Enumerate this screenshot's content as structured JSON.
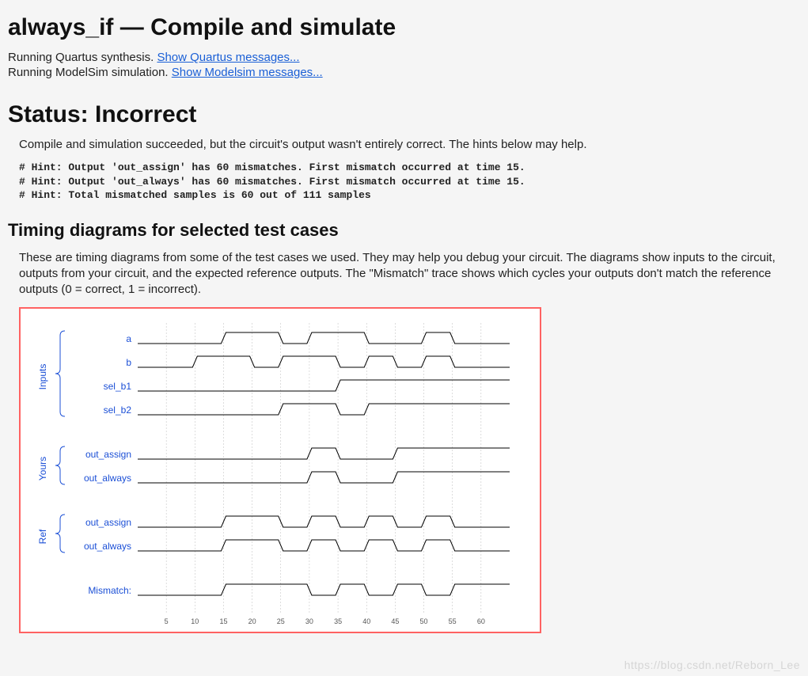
{
  "title": "always_if — Compile and simulate",
  "run": {
    "quartus_prefix": "Running Quartus synthesis. ",
    "quartus_link": "Show Quartus messages...",
    "modelsim_prefix": "Running ModelSim simulation. ",
    "modelsim_link": "Show Modelsim messages..."
  },
  "status": {
    "heading": "Status: Incorrect",
    "desc": "Compile and simulation succeeded, but the circuit's output wasn't entirely correct. The hints below may help."
  },
  "hints": "# Hint: Output 'out_assign' has 60 mismatches. First mismatch occurred at time 15.\n# Hint: Output 'out_always' has 60 mismatches. First mismatch occurred at time 15.\n# Hint: Total mismatched samples is 60 out of 111 samples",
  "timing": {
    "heading": "Timing diagrams for selected test cases",
    "desc": "These are timing diagrams from some of the test cases we used. They may help you debug your circuit. The diagrams show inputs to the circuit, outputs from your circuit, and the expected reference outputs. The \"Mismatch\" trace shows which cycles your outputs don't match the reference outputs (0 = correct, 1 = incorrect)."
  },
  "chart_data": {
    "type": "timing_diagram",
    "time_start": 5,
    "time_end": 62,
    "ticks": [
      5,
      10,
      15,
      20,
      25,
      30,
      35,
      40,
      45,
      50,
      55,
      60
    ],
    "groups": [
      {
        "name": "Inputs",
        "signals": [
          "a",
          "b",
          "sel_b1",
          "sel_b2"
        ]
      },
      {
        "name": "Yours",
        "signals": [
          "out_assign",
          "out_always"
        ]
      },
      {
        "name": "Ref",
        "signals": [
          "out_assign",
          "out_always"
        ]
      },
      {
        "name": "",
        "signals": [
          "Mismatch:"
        ]
      }
    ],
    "signals": {
      "a": {
        "init": 0,
        "transitions": [
          15,
          25,
          30,
          40,
          50,
          55
        ]
      },
      "b": {
        "init": 0,
        "transitions": [
          10,
          20,
          25,
          35,
          40,
          45,
          50,
          55
        ]
      },
      "sel_b1": {
        "init": 0,
        "transitions": [
          35
        ]
      },
      "sel_b2": {
        "init": 0,
        "transitions": [
          25,
          35,
          40
        ]
      },
      "yours_out_assign": {
        "init": 0,
        "transitions": [
          30,
          35,
          45
        ]
      },
      "yours_out_always": {
        "init": 0,
        "transitions": [
          30,
          35,
          45
        ]
      },
      "ref_out_assign": {
        "init": 0,
        "transitions": [
          15,
          25,
          30,
          35,
          40,
          45,
          50,
          55
        ]
      },
      "ref_out_always": {
        "init": 0,
        "transitions": [
          15,
          25,
          30,
          35,
          40,
          45,
          50,
          55
        ]
      },
      "mismatch": {
        "init": 0,
        "transitions": [
          15,
          30,
          35,
          40,
          45,
          50,
          55
        ]
      }
    }
  },
  "watermark": "https://blog.csdn.net/Reborn_Lee"
}
